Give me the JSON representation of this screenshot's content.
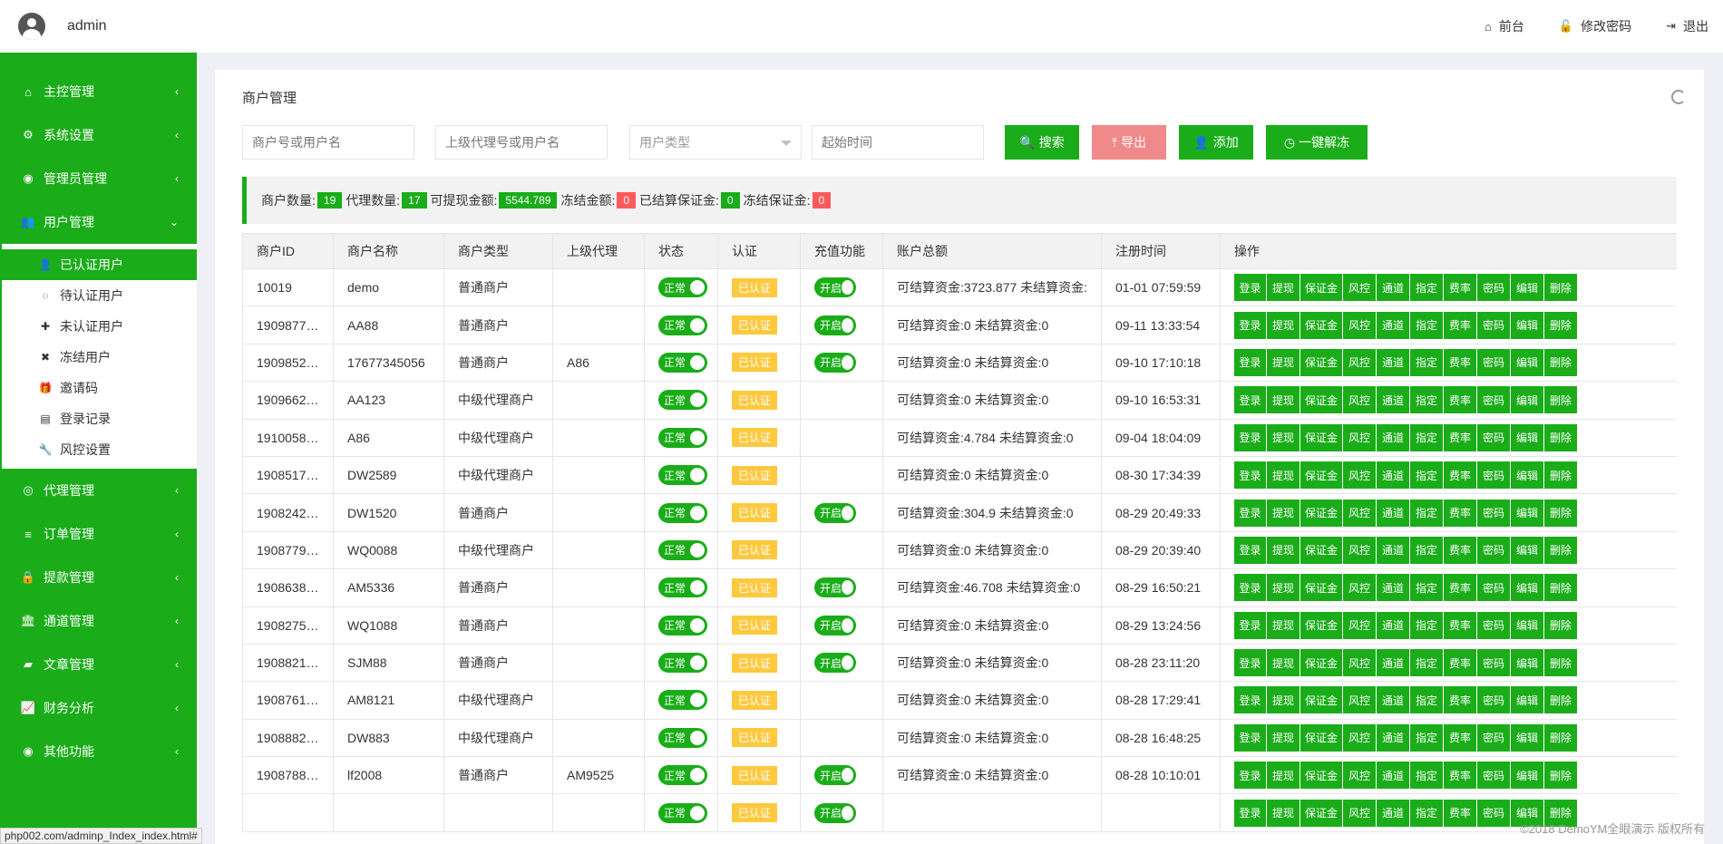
{
  "topbar": {
    "username": "admin",
    "links": [
      {
        "icon": "home-icon",
        "glyph": "⌂",
        "label": "前台"
      },
      {
        "icon": "lock-icon",
        "glyph": "🔓",
        "label": "修改密码"
      },
      {
        "icon": "logout-icon",
        "glyph": "⇥",
        "label": "退出"
      }
    ]
  },
  "sidebar": {
    "items": [
      {
        "icon": "home-icon",
        "glyph": "⌂",
        "label": "主控管理"
      },
      {
        "icon": "gears-icon",
        "glyph": "⚙",
        "label": "系统设置"
      },
      {
        "icon": "user-circle-icon",
        "glyph": "◉",
        "label": "管理员管理"
      },
      {
        "icon": "users-icon",
        "glyph": "👥",
        "label": "用户管理"
      }
    ],
    "submenu": [
      {
        "icon": "user-icon",
        "glyph": "👤",
        "label": "已认证用户"
      },
      {
        "icon": "user-outline-icon",
        "glyph": "◌",
        "label": "待认证用户"
      },
      {
        "icon": "user-plus-icon",
        "glyph": "✚",
        "label": "未认证用户"
      },
      {
        "icon": "user-times-icon",
        "glyph": "✖",
        "label": "冻结用户"
      },
      {
        "icon": "gift-icon",
        "glyph": "🎁",
        "label": "邀请码"
      },
      {
        "icon": "address-book-icon",
        "glyph": "▤",
        "label": "登录记录"
      },
      {
        "icon": "wrench-icon",
        "glyph": "🔧",
        "label": "风控设置"
      }
    ],
    "items2": [
      {
        "icon": "handshake-icon",
        "glyph": "◎",
        "label": "代理管理"
      },
      {
        "icon": "list-icon",
        "glyph": "≡",
        "label": "订单管理"
      },
      {
        "icon": "lock-icon",
        "glyph": "🔒",
        "label": "提款管理"
      },
      {
        "icon": "bank-icon",
        "glyph": "🏛",
        "label": "通道管理"
      },
      {
        "icon": "book-icon",
        "glyph": "▰",
        "label": "文章管理"
      },
      {
        "icon": "chart-icon",
        "glyph": "📈",
        "label": "财务分析"
      },
      {
        "icon": "user-circle-icon",
        "glyph": "◉",
        "label": "其他功能"
      }
    ]
  },
  "panel": {
    "title": "商户管理"
  },
  "filters": {
    "merchant_placeholder": "商户号或用户名",
    "agent_placeholder": "上级代理号或用户名",
    "type_placeholder": "用户类型",
    "start_placeholder": "起始时间",
    "search_label": "搜索",
    "export_label": "导出",
    "add_label": "添加",
    "unfreeze_label": "一键解冻"
  },
  "stats": {
    "merchant_label": "商户数量:",
    "merchant_value": "19",
    "agent_label": "代理数量:",
    "agent_value": "17",
    "withdraw_label": "可提现金额:",
    "withdraw_value": "5544.789",
    "frozen_label": "冻结金额:",
    "frozen_value": "0",
    "settled_label": "已结算保证金:",
    "settled_value": "0",
    "frozen_deposit_label": "冻结保证金:",
    "frozen_deposit_value": "0"
  },
  "table": {
    "headers": [
      "商户ID",
      "商户名称",
      "商户类型",
      "上级代理",
      "状态",
      "认证",
      "充值功能",
      "账户总额",
      "注册时间",
      "操作"
    ],
    "status_label": "正常",
    "auth_label": "已认证",
    "recharge_label": "开启",
    "ops": [
      "登录",
      "提现",
      "保证金",
      "风控",
      "通道",
      "指定",
      "费率",
      "密码",
      "编辑",
      "删除"
    ],
    "rows": [
      {
        "id": "10019",
        "name": "demo",
        "type": "普通商户",
        "agent": "",
        "recharge": true,
        "balance": "可结算资金:3723.877 未结算资金:",
        "time": "01-01 07:59:59"
      },
      {
        "id": "1909877…",
        "name": "AA88",
        "type": "普通商户",
        "agent": "",
        "recharge": true,
        "balance": "可结算资金:0 未结算资金:0",
        "time": "09-11 13:33:54"
      },
      {
        "id": "1909852…",
        "name": "17677345056",
        "type": "普通商户",
        "agent": "A86",
        "recharge": true,
        "balance": "可结算资金:0 未结算资金:0",
        "time": "09-10 17:10:18"
      },
      {
        "id": "1909662…",
        "name": "AA123",
        "type": "中级代理商户",
        "agent": "",
        "recharge": false,
        "balance": "可结算资金:0 未结算资金:0",
        "time": "09-10 16:53:31"
      },
      {
        "id": "1910058…",
        "name": "A86",
        "type": "中级代理商户",
        "agent": "",
        "recharge": false,
        "balance": "可结算资金:4.784 未结算资金:0",
        "time": "09-04 18:04:09"
      },
      {
        "id": "1908517…",
        "name": "DW2589",
        "type": "中级代理商户",
        "agent": "",
        "recharge": false,
        "balance": "可结算资金:0 未结算资金:0",
        "time": "08-30 17:34:39"
      },
      {
        "id": "1908242…",
        "name": "DW1520",
        "type": "普通商户",
        "agent": "",
        "recharge": true,
        "balance": "可结算资金:304.9 未结算资金:0",
        "time": "08-29 20:49:33"
      },
      {
        "id": "1908779…",
        "name": "WQ0088",
        "type": "中级代理商户",
        "agent": "",
        "recharge": false,
        "balance": "可结算资金:0 未结算资金:0",
        "time": "08-29 20:39:40"
      },
      {
        "id": "1908638…",
        "name": "AM5336",
        "type": "普通商户",
        "agent": "",
        "recharge": true,
        "balance": "可结算资金:46.708 未结算资金:0",
        "time": "08-29 16:50:21"
      },
      {
        "id": "1908275…",
        "name": "WQ1088",
        "type": "普通商户",
        "agent": "",
        "recharge": true,
        "balance": "可结算资金:0 未结算资金:0",
        "time": "08-29 13:24:56"
      },
      {
        "id": "1908821…",
        "name": "SJM88",
        "type": "普通商户",
        "agent": "",
        "recharge": true,
        "balance": "可结算资金:0 未结算资金:0",
        "time": "08-28 23:11:20"
      },
      {
        "id": "1908761…",
        "name": "AM8121",
        "type": "中级代理商户",
        "agent": "",
        "recharge": false,
        "balance": "可结算资金:0 未结算资金:0",
        "time": "08-28 17:29:41"
      },
      {
        "id": "1908882…",
        "name": "DW883",
        "type": "中级代理商户",
        "agent": "",
        "recharge": false,
        "balance": "可结算资金:0 未结算资金:0",
        "time": "08-28 16:48:25"
      },
      {
        "id": "1908788…",
        "name": "lf2008",
        "type": "普通商户",
        "agent": "AM9525",
        "recharge": true,
        "balance": "可结算资金:0 未结算资金:0",
        "time": "08-28 10:10:01"
      },
      {
        "id": "",
        "name": "",
        "type": "",
        "agent": "",
        "recharge": true,
        "balance": "",
        "time": ""
      }
    ]
  },
  "footer": "©2018 DemoYM全眼演示 版权所有",
  "status_url": "php002.com/adminp_Index_index.html#"
}
